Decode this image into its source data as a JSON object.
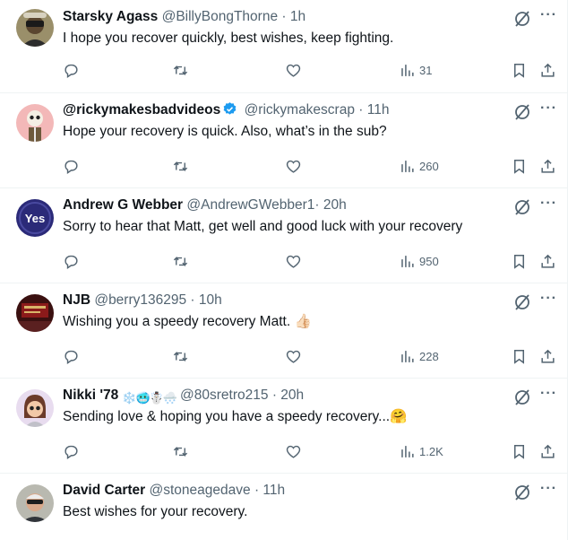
{
  "tweets": [
    {
      "name": "Starsky Agass",
      "handle": "@BillyBongThorne",
      "time": "1h",
      "text": "I hope you recover quickly, best wishes, keep fighting.",
      "views": "31",
      "verified": false
    },
    {
      "name": "@rickymakesbadvideos",
      "handle": "@rickymakescrap",
      "time": "11h",
      "text": "Hope your recovery is quick. Also, what’s in the sub?",
      "views": "260",
      "verified": true
    },
    {
      "name": "Andrew G Webber",
      "handle": "@AndrewGWebber1",
      "time": "20h",
      "text": "Sorry to hear that Matt, get well and good luck with your recovery",
      "views": "950",
      "verified": false,
      "avatar_text": "Yes"
    },
    {
      "name": "NJB",
      "handle": "@berry136295",
      "time": "10h",
      "text": "Wishing you a speedy recovery Matt. 👍🏻",
      "views": "228",
      "verified": false
    },
    {
      "name": "Nikki '78",
      "name_emojis": "❄️🥶☃️🌨️",
      "handle": "@80sretro215",
      "time": "20h",
      "text": "Sending love & hoping you have a speedy recovery...🤗",
      "views": "1.2K",
      "verified": false
    },
    {
      "name": "David Carter",
      "handle": "@stoneagedave",
      "time": "11h",
      "text": "Best wishes for your recovery.",
      "views": "",
      "verified": false
    }
  ],
  "separator": "·",
  "more_label": "···",
  "colors": {
    "accent": "#1d9bf0",
    "muted": "#536471",
    "text": "#0f1419",
    "border": "#eff3f4"
  }
}
